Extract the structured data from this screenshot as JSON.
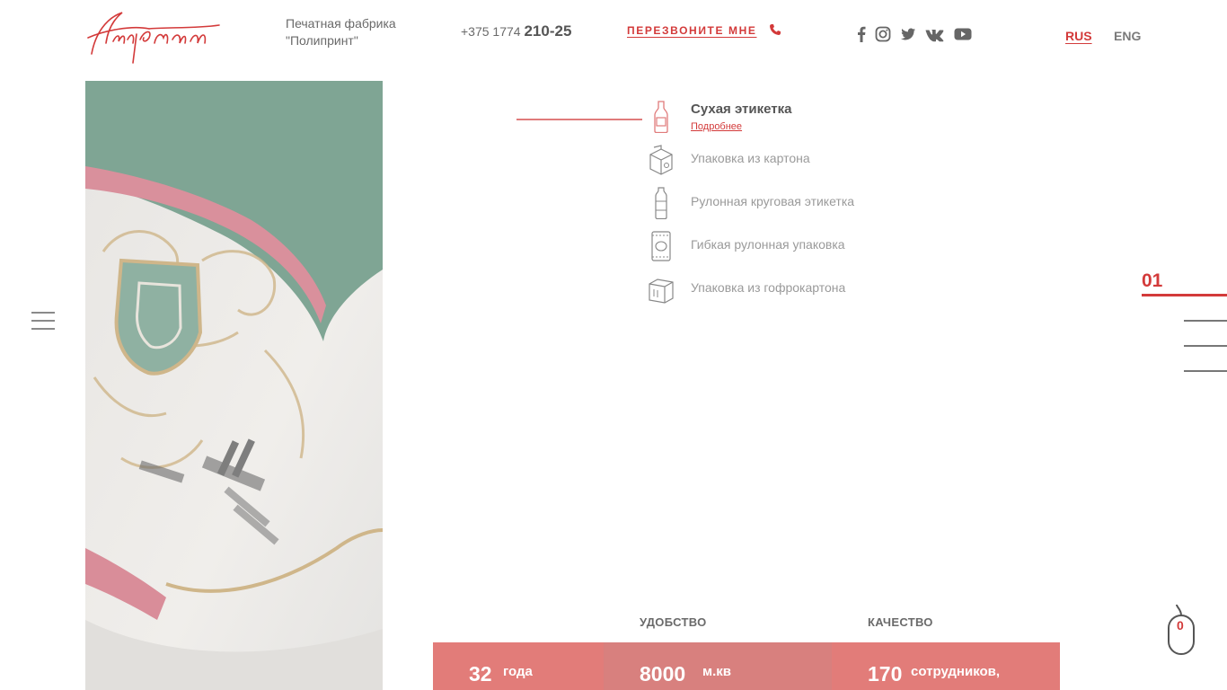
{
  "header": {
    "tagline": "Печатная фабрика \"Полипринт\"",
    "phone_prefix": "+375 1774",
    "phone_main": "210-25",
    "callback_label": "ПЕРЕЗВОНИТЕ МНЕ",
    "socials": [
      "facebook-icon",
      "instagram-icon",
      "twitter-icon",
      "vk-icon",
      "youtube-icon"
    ],
    "languages": [
      {
        "label": "RUS",
        "active": true
      },
      {
        "label": "ENG",
        "active": false
      }
    ]
  },
  "products": [
    {
      "label": "Сухая этикетка",
      "icon": "bottle-icon",
      "active": true,
      "more_label": "Подробнее"
    },
    {
      "label": "Упаковка из картона",
      "icon": "carton-box-icon",
      "active": false
    },
    {
      "label": "Рулонная круговая этикетка",
      "icon": "plastic-bottle-icon",
      "active": false
    },
    {
      "label": "Гибкая рулонная упаковка",
      "icon": "flexible-pack-icon",
      "active": false
    },
    {
      "label": "Упаковка из гофрокартона",
      "icon": "corrugated-box-icon",
      "active": false
    }
  ],
  "slider": {
    "current": "01"
  },
  "scroll_indicator": {
    "value": "0"
  },
  "stats": [
    {
      "title": "",
      "value": "32",
      "unit": "года"
    },
    {
      "title": "УДОБСТВО",
      "value": "8000",
      "unit": "м.кв"
    },
    {
      "title": "КАЧЕСТВО",
      "value": "170",
      "unit": "сотрудников,"
    }
  ],
  "colors": {
    "accent": "#d33a3a",
    "band": "#e27c79",
    "text": "#555555"
  }
}
